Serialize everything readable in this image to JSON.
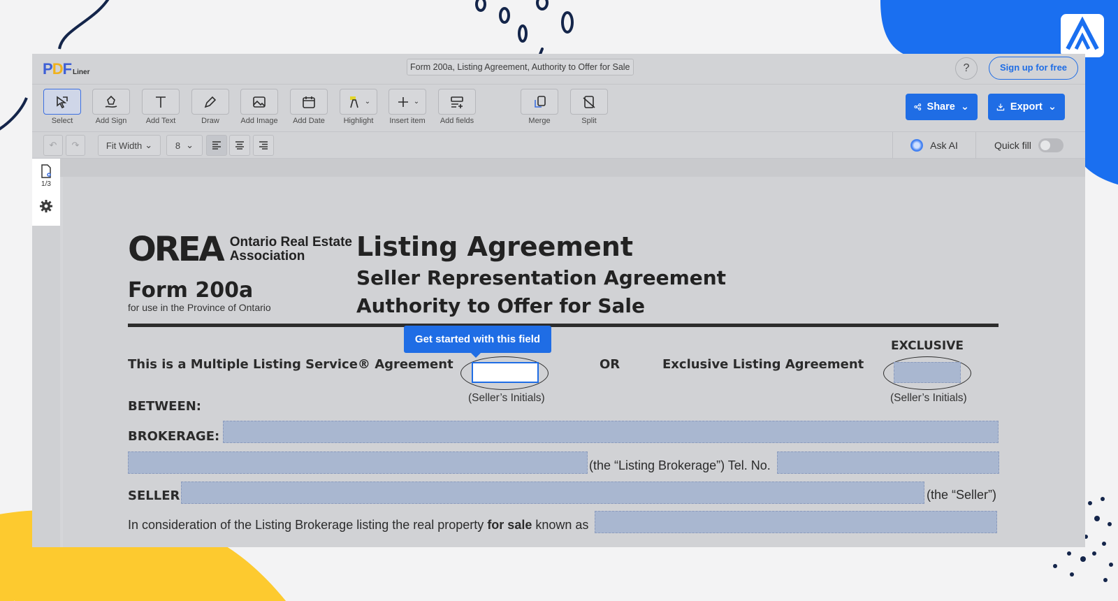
{
  "app": {
    "logo": {
      "p": "P",
      "d": "D",
      "f": "F",
      "liner": "Liner"
    },
    "document_title": "Form 200a, Listing Agreement, Authority to Offer for Sale",
    "help_label": "?",
    "signup_label": "Sign up for free"
  },
  "toolbar": {
    "tools": [
      {
        "id": "select",
        "label": "Select",
        "icon": "cursor-icon"
      },
      {
        "id": "add-sign",
        "label": "Add Sign",
        "icon": "signature-pen-icon"
      },
      {
        "id": "add-text",
        "label": "Add Text",
        "icon": "text-t-icon"
      },
      {
        "id": "draw",
        "label": "Draw",
        "icon": "pen-icon"
      },
      {
        "id": "add-image",
        "label": "Add Image",
        "icon": "image-icon"
      },
      {
        "id": "add-date",
        "label": "Add Date",
        "icon": "calendar-icon"
      },
      {
        "id": "highlight",
        "label": "Highlight",
        "icon": "highlighter-icon"
      },
      {
        "id": "insert-item",
        "label": "Insert item",
        "icon": "plus-icon"
      },
      {
        "id": "add-fields",
        "label": "Add fields",
        "icon": "form-fields-icon"
      },
      {
        "id": "merge",
        "label": "Merge",
        "icon": "merge-icon"
      },
      {
        "id": "split",
        "label": "Split",
        "icon": "split-icon"
      }
    ],
    "share_label": "Share",
    "export_label": "Export"
  },
  "formatbar": {
    "zoom_label": "Fit Width",
    "font_size": "8",
    "ask_ai_label": "Ask AI",
    "quick_fill_label": "Quick fill",
    "quick_fill_on": false
  },
  "sidepanel": {
    "page_indicator": "1/3"
  },
  "document": {
    "orea_mark": "OREA",
    "orea_line1": "Ontario Real Estate",
    "orea_line2": "Association",
    "form_number": "Form 200a",
    "form_sub": "for use in the Province of Ontario",
    "title_line1": "Listing Agreement",
    "title_line2": "Seller Representation Agreement",
    "title_line3": "Authority to Offer for Sale",
    "tooltip": "Get started with this field",
    "mls_label": "This is a Multiple Listing Service® Agreement",
    "or_label": "OR",
    "exclusive_label": "Exclusive Listing Agreement",
    "exclusive_heading": "EXCLUSIVE",
    "sellers_initials_1": "(Seller’s Initials)",
    "sellers_initials_2": "(Seller’s Initials)",
    "between_label": "BETWEEN:",
    "brokerage_label": "BROKERAGE:",
    "listing_brokerage_text": "(the “Listing Brokerage”) Tel. No.",
    "seller_label": "SELLER:",
    "the_seller_text": "(the “Seller”)",
    "consideration_text_1": "In consideration of the Listing Brokerage listing the real property",
    "consideration_bold": "for sale",
    "consideration_text_2": "known as"
  },
  "colors": {
    "accent": "#1f6de5",
    "field_fill": "#a9b7d0",
    "brand_yellow": "#fdca2f",
    "brand_blue": "#1a6ff0"
  }
}
